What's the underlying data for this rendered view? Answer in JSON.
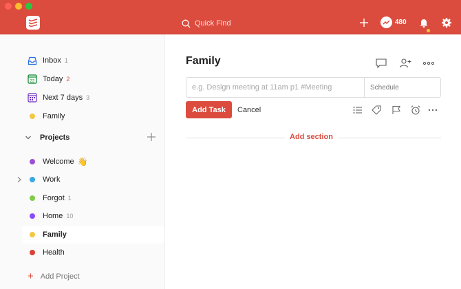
{
  "header": {
    "quick_find_placeholder": "Quick Find",
    "karma_points": "480",
    "brand_color": "#db4c3f"
  },
  "sidebar": {
    "inbox": {
      "label": "Inbox",
      "count": "1"
    },
    "today": {
      "label": "Today",
      "count": "2",
      "date": "22"
    },
    "next7": {
      "label": "Next 7 days",
      "count": "3"
    },
    "favorite": {
      "label": "Family",
      "color": "#f2c744"
    },
    "projects_label": "Projects",
    "projects": [
      {
        "label": "Welcome",
        "emoji": "👋",
        "count": "",
        "color": "#9c4fd6"
      },
      {
        "label": "Work",
        "count": "",
        "color": "#3aa7e0"
      },
      {
        "label": "Forgot",
        "count": "1",
        "color": "#7ecc49"
      },
      {
        "label": "Home",
        "count": "10",
        "color": "#884dff"
      },
      {
        "label": "Family",
        "count": "",
        "color": "#f2c744"
      },
      {
        "label": "Health",
        "count": "",
        "color": "#db4035"
      }
    ],
    "add_project_label": "Add Project"
  },
  "main": {
    "title": "Family",
    "task_input_placeholder": "e.g. Design meeting at 11am p1 #Meeting",
    "schedule_label": "Schedule",
    "add_task_label": "Add Task",
    "cancel_label": "Cancel",
    "add_section_label": "Add section"
  }
}
